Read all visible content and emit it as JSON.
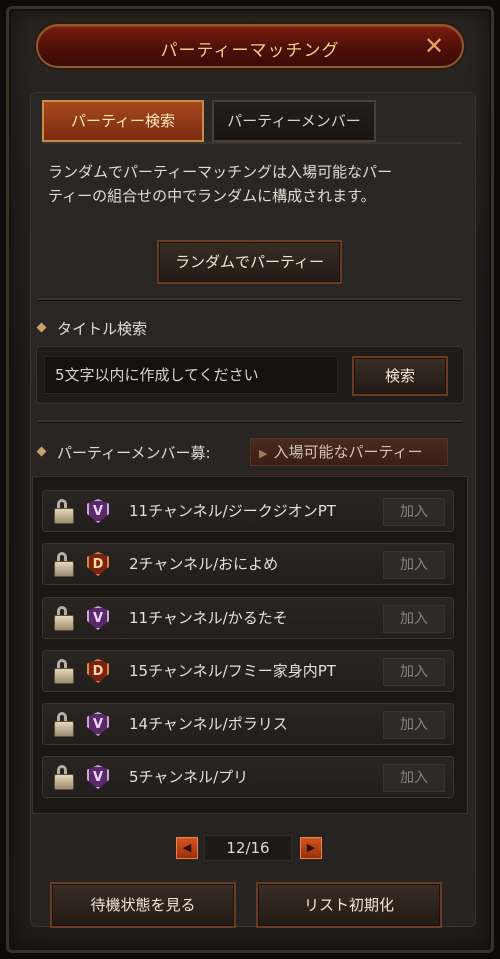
{
  "window": {
    "title": "パーティーマッチング",
    "close_icon": "close-icon"
  },
  "tabs": [
    {
      "label": "パーティー検索",
      "active": true
    },
    {
      "label": "パーティーメンバー",
      "active": false
    }
  ],
  "description": [
    "ランダムでパーティーマッチングは入場可能なパー",
    "ティーの組合せの中でランダムに構成されます。"
  ],
  "random_button": "ランダムでパーティー",
  "title_search": {
    "label": "タイトル検索",
    "placeholder": "5文字以内に作成してください",
    "button": "検索"
  },
  "party_list": {
    "label": "パーティーメンバー募:",
    "filter": "入場可能なパーティー",
    "rows": [
      {
        "emblem": "V",
        "name": "11チャンネル/ジークジオンPT",
        "join": "加入"
      },
      {
        "emblem": "D",
        "name": "2チャンネル/おによめ",
        "join": "加入"
      },
      {
        "emblem": "V",
        "name": "11チャンネル/かるたそ",
        "join": "加入"
      },
      {
        "emblem": "D",
        "name": "15チャンネル/フミー家身内PT",
        "join": "加入"
      },
      {
        "emblem": "V",
        "name": "14チャンネル/ポラリス",
        "join": "加入"
      },
      {
        "emblem": "V",
        "name": "5チャンネル/プリ",
        "join": "加入"
      }
    ]
  },
  "pager": {
    "current": 12,
    "total": 16,
    "text": "12/16"
  },
  "bottom_buttons": {
    "wait": "待機状態を見る",
    "reset": "リスト初期化"
  },
  "colors": {
    "accent": "#a7491d",
    "title_text": "#f2d28a",
    "title_bar": "#5a1208"
  }
}
